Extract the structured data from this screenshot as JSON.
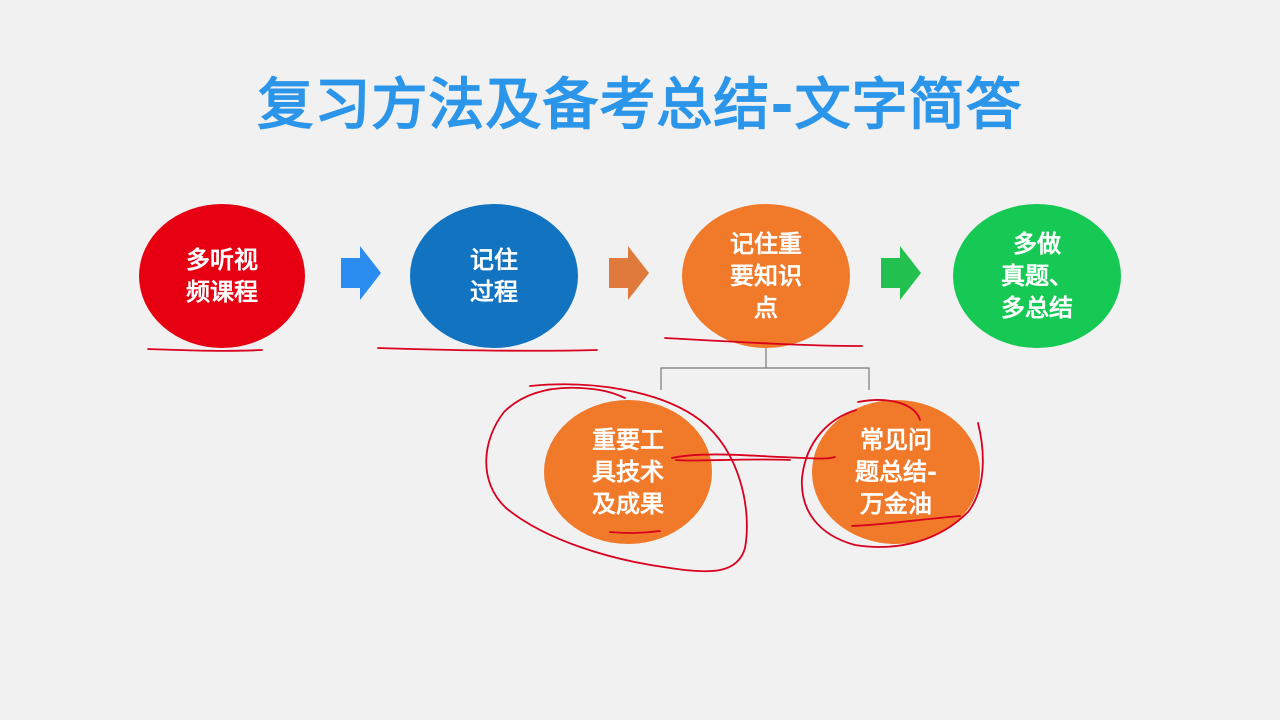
{
  "title": "复习方法及备考总结-文字简答",
  "nodes": {
    "n1": "多听视\n频课程",
    "n2": "记住\n过程",
    "n3": "记住重\n要知识\n点",
    "n4": "多做\n真题、\n多总结",
    "n5": "重要工\n具技术\n及成果",
    "n6": "常见问\n题总结-\n万金油"
  },
  "colors": {
    "title": "#2b95e9",
    "red": "#e60012",
    "blue": "#1273c1",
    "orange": "#f07a2a",
    "green": "#16c954",
    "arrow_blue": "#2b8cf0",
    "arrow_orange": "#e07a3c",
    "arrow_green": "#22c14f",
    "annotation": "#d8001e"
  }
}
